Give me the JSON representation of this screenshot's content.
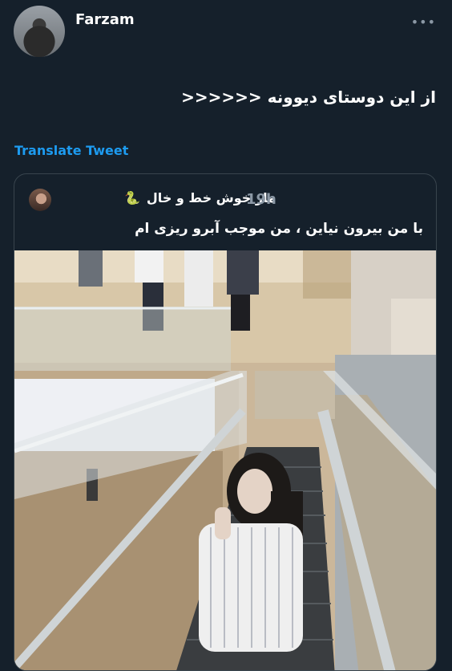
{
  "author": {
    "name": "Farzam"
  },
  "more_icon": "more-dots-icon",
  "tweet": {
    "text": "از این دوستای دیوونه <<<<<<",
    "translate_label": "Translate Tweet"
  },
  "quote": {
    "author_name": "مار خوش خط و خال",
    "emoji": "🐍",
    "time": "19h",
    "text": "با من بیرون نیاین ، من موجب آبرو ریزی ام"
  },
  "colors": {
    "background": "#15202b",
    "link": "#1d9bf0",
    "muted": "#8b98a5",
    "border": "#38444d"
  }
}
